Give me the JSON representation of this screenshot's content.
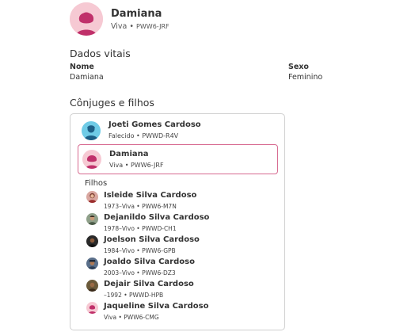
{
  "profile": {
    "name": "Damiana",
    "status": "Viva",
    "separator": "•",
    "id": "PWW6-JRF"
  },
  "vitals": {
    "title": "Dados vitais",
    "name_label": "Nome",
    "name_value": "Damiana",
    "sex_label": "Sexo",
    "sex_value": "Feminino"
  },
  "family": {
    "title": "Cônjuges e filhos",
    "spouse": {
      "name": "Joeti Gomes Cardoso",
      "sub": "Falecido • PWWD-R4V"
    },
    "self": {
      "name": "Damiana",
      "sub": "Viva • PWW6-JRF"
    },
    "children_label": "Filhos",
    "children": [
      {
        "name": "Isleide Silva Cardoso",
        "sub": "1973–Viva • PWW6-M7N",
        "avatar": "female-photo"
      },
      {
        "name": "Dejanildo Silva Cardoso",
        "sub": "1978–Vivo • PWWD-CH1",
        "avatar": "male-photo"
      },
      {
        "name": "Joelson Silva Cardoso",
        "sub": "1984–Vivo • PWW6-GPB",
        "avatar": "male-photo"
      },
      {
        "name": "Joaldo Silva Cardoso",
        "sub": "2003–Vivo • PWW6-DZ3",
        "avatar": "male-photo"
      },
      {
        "name": "Dejair Silva Cardoso",
        "sub": "–1992 • PWWD-HPB",
        "avatar": "male-photo"
      },
      {
        "name": "Jaqueline Silva Cardoso",
        "sub": "Viva • PWW6-CMG",
        "avatar": "female-silhouette"
      }
    ]
  },
  "colors": {
    "female_bg": "#f6c9d3",
    "female_fg": "#c0306a",
    "male_bg": "#6fcbe6",
    "male_fg": "#1d5f86",
    "selected_border": "#d76a90"
  }
}
